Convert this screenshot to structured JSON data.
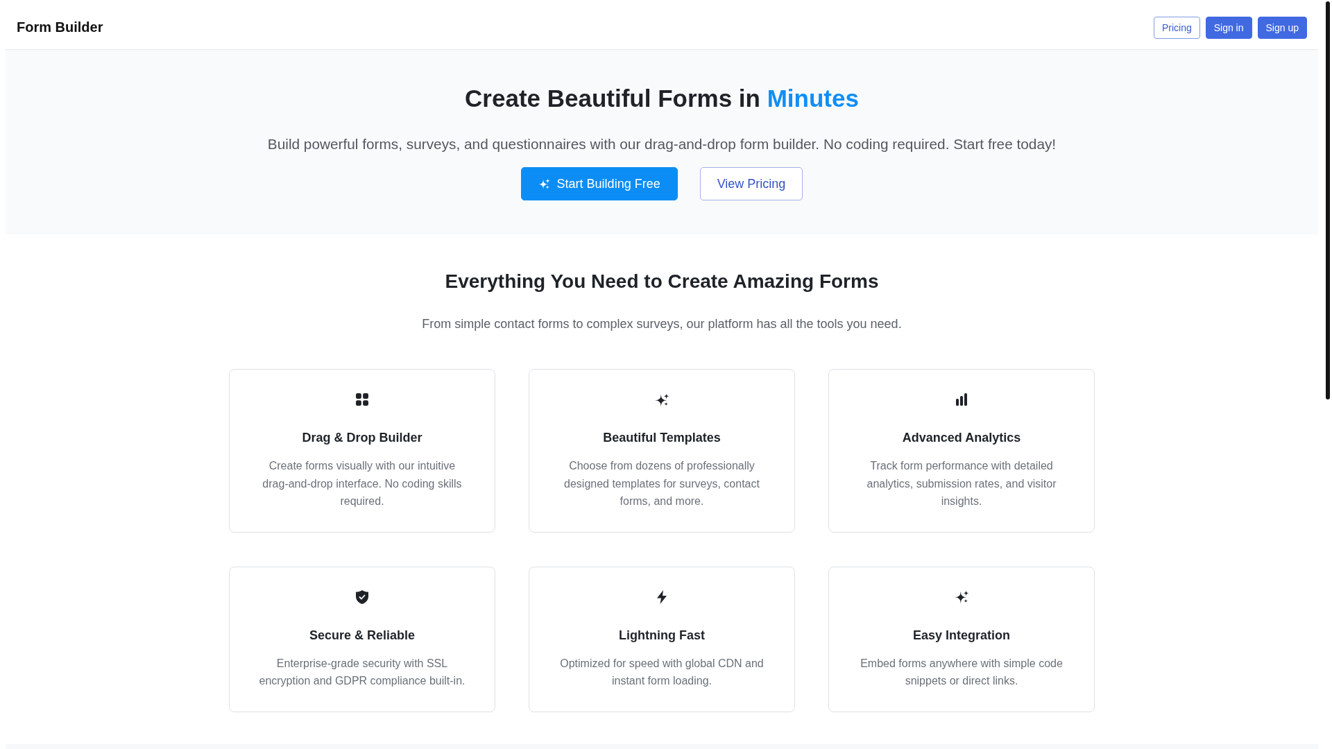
{
  "header": {
    "brand": "Form Builder",
    "buttons": [
      {
        "label": "Pricing",
        "kind": "outline"
      },
      {
        "label": "Sign in",
        "kind": "solid"
      },
      {
        "label": "Sign up",
        "kind": "solid"
      }
    ]
  },
  "hero": {
    "title": "Create Beautiful Forms in",
    "title_highlight": "Minutes",
    "subtitle": "Build powerful forms, surveys, and questionnaires with our drag-and-drop form builder. No coding required. Start free today!",
    "buttons": [
      {
        "label": "Start Building Free",
        "kind": "primary"
      },
      {
        "label": "View Pricing",
        "kind": "secondary"
      }
    ]
  },
  "features": {
    "title": "Everything You Need to Create Amazing Forms",
    "subtitle": "From simple contact forms to complex surveys, our platform has all the tools you need.",
    "cards": [
      {
        "title": "Drag & Drop Builder",
        "description": "Create forms visually with our intuitive drag-and-drop interface. No coding skills required."
      },
      {
        "title": "Beautiful Templates",
        "description": "Choose from dozens of professionally designed templates for surveys, contact forms, and more."
      },
      {
        "title": "Advanced Analytics",
        "description": "Track form performance with detailed analytics, submission rates, and visitor insights."
      },
      {
        "title": "Secure & Reliable",
        "description": "Enterprise-grade security with SSL encryption and GDPR compliance built-in."
      },
      {
        "title": "Lightning Fast",
        "description": "Optimized for speed with global CDN and instant form loading."
      },
      {
        "title": "Easy Integration",
        "description": "Embed forms anywhere with simple code snippets or direct links."
      }
    ]
  }
}
